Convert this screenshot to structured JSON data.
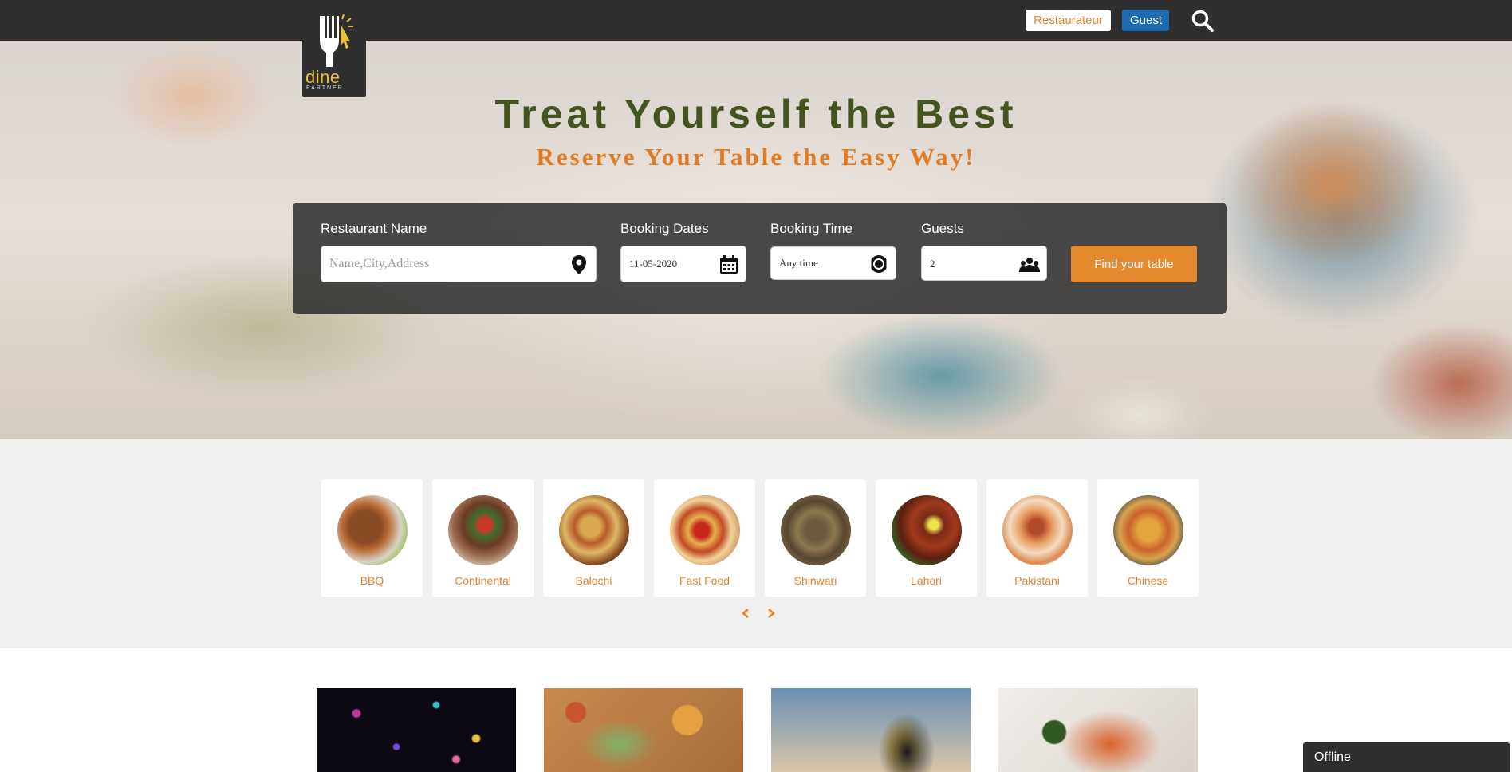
{
  "nav": {
    "brand_word": "dine",
    "brand_sub": "PARTNER",
    "restaurateur_label": "Restaurateur",
    "guest_label": "Guest",
    "search_icon": "search-icon"
  },
  "hero": {
    "title": "Treat Yourself the Best",
    "subtitle": "Reserve Your Table the Easy Way!",
    "labels": {
      "restaurant": "Restaurant Name",
      "dates": "Booking Dates",
      "time": "Booking Time",
      "guests": "Guests"
    },
    "restaurant_placeholder": "Name,City,Address",
    "booking_date": "11-05-2020",
    "booking_time": "Any time",
    "guests_value": "2",
    "find_label": "Find your table"
  },
  "categories": [
    {
      "label": "BBQ"
    },
    {
      "label": "Continental"
    },
    {
      "label": "Balochi"
    },
    {
      "label": "Fast Food"
    },
    {
      "label": "Shinwari"
    },
    {
      "label": "Lahori"
    },
    {
      "label": "Pakistani"
    },
    {
      "label": "Chinese"
    }
  ],
  "chat": {
    "status": "Offline"
  },
  "colors": {
    "accent": "#e5892f",
    "guest_blue": "#1d6bb1",
    "navbar": "#2f2f2f",
    "title_green": "#44541f"
  }
}
